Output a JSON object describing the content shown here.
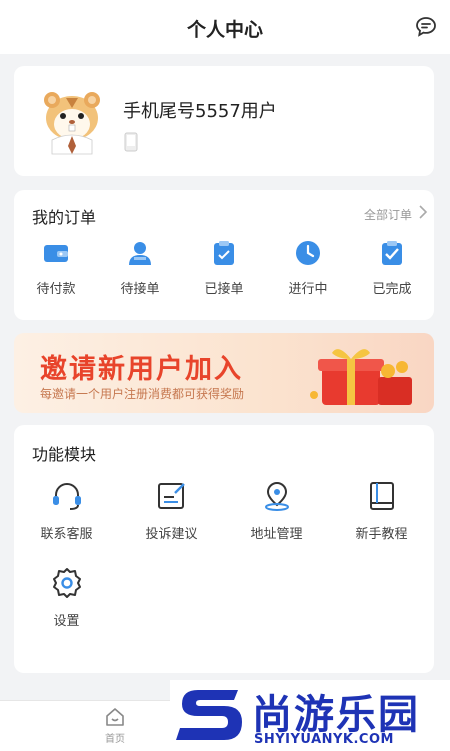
{
  "header": {
    "title": "个人中心",
    "message_icon": "chat-bubble-icon"
  },
  "profile": {
    "username": "手机尾号5557用户",
    "avatar_icon": "hamster-avatar",
    "phone_icon": "phone-icon"
  },
  "orders": {
    "title": "我的订单",
    "all_label": "全部订单",
    "items": [
      {
        "label": "待付款",
        "icon": "wallet-icon"
      },
      {
        "label": "待接单",
        "icon": "person-icon"
      },
      {
        "label": "已接单",
        "icon": "clipboard-icon"
      },
      {
        "label": "进行中",
        "icon": "clock-icon"
      },
      {
        "label": "已完成",
        "icon": "check-clipboard-icon"
      }
    ]
  },
  "banner": {
    "title": "邀请新用户加入",
    "subtitle": "每邀请一个用户注册消费都可获得奖励",
    "graphic": "gift-box-icon"
  },
  "modules": {
    "title": "功能模块",
    "items": [
      {
        "label": "联系客服",
        "icon": "headset-icon"
      },
      {
        "label": "投诉建议",
        "icon": "edit-note-icon"
      },
      {
        "label": "地址管理",
        "icon": "location-pin-icon"
      },
      {
        "label": "新手教程",
        "icon": "book-icon"
      },
      {
        "label": "设置",
        "icon": "gear-icon"
      }
    ]
  },
  "tabbar": {
    "home_label": "首页",
    "home_icon": "home-icon"
  },
  "watermark": {
    "name": "尚游乐园",
    "url": "SHYIYUANYK.COM"
  },
  "colors": {
    "accent": "#3a8ee6",
    "banner_text": "#e8442b",
    "watermark": "#1e33b5"
  }
}
